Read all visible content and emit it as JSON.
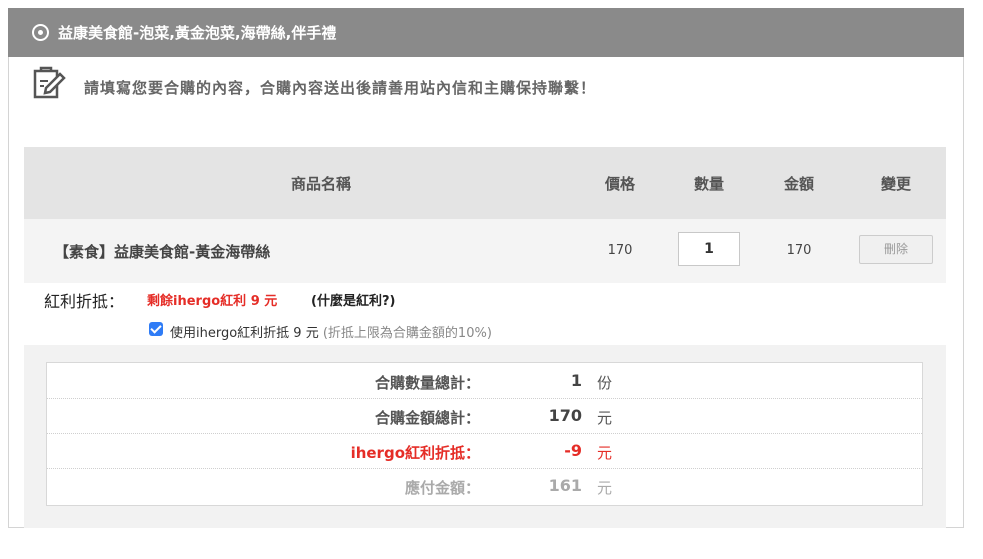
{
  "header": {
    "title": "益康美食館-泡菜,黃金泡菜,海帶絲,伴手禮"
  },
  "notice": {
    "text": "請填寫您要合購的內容，合購內容送出後請善用站內信和主購保持聯繫！"
  },
  "table": {
    "columns": [
      "商品名稱",
      "價格",
      "數量",
      "金額",
      "變更"
    ],
    "row": {
      "product": "【素食】益康美食館-黃金海帶絲",
      "price": "170",
      "qty": "1",
      "amount": "170",
      "delete_label": "刪除"
    }
  },
  "bonus": {
    "label": "紅利折抵：",
    "remaining": "剩餘ihergo紅利 9 元",
    "what_link": "(什麼是紅利?)",
    "checkbox_checked": true,
    "checkbox_label": "使用ihergo紅利折抵 9 元",
    "checkbox_hint": "(折抵上限為合購金額的10%)"
  },
  "summary": [
    {
      "label": "合購數量總計：",
      "value": "1",
      "unit": "份"
    },
    {
      "label": "合購金額總計：",
      "value": "170",
      "unit": "元"
    },
    {
      "label": "ihergo紅利折抵：",
      "value": "-9",
      "unit": "元"
    },
    {
      "label": "應付金額：",
      "value": "161",
      "unit": "元"
    }
  ],
  "colors": {
    "title_bar": "#8a8a8a",
    "accent_red": "#e52d27",
    "checkbox_blue": "#2f7cf6"
  }
}
